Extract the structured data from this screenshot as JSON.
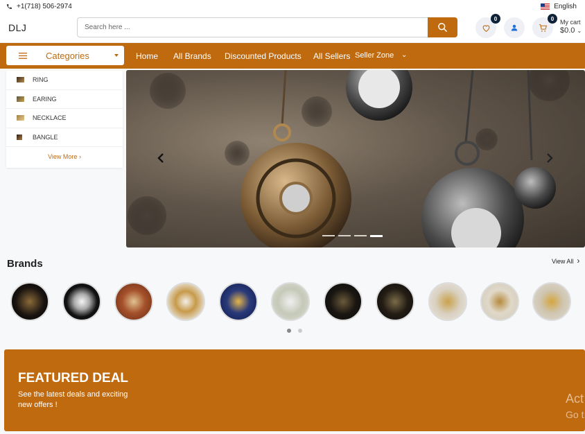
{
  "topbar": {
    "phone": "+1(718) 506-2974",
    "language": "English"
  },
  "header": {
    "logo": "DLJ",
    "search_placeholder": "Search here ...",
    "wishlist_count": "0",
    "cart_count": "0",
    "cart_label": "My cart",
    "cart_amount": "$0.0"
  },
  "nav": {
    "categories_label": "Categories",
    "links": [
      "Home",
      "All Brands",
      "Discounted Products",
      "All Sellers",
      "Seller Zone"
    ]
  },
  "categories": [
    {
      "label": "RING",
      "icon": "ring-thumbnail"
    },
    {
      "label": "EARING",
      "icon": "earing-thumbnail"
    },
    {
      "label": "NECKLACE",
      "icon": "necklace-thumbnail"
    },
    {
      "label": "BANGLE",
      "icon": "bangle-thumbnail"
    }
  ],
  "view_more": "View More",
  "brands": {
    "title": "Brands",
    "view_all": "View All"
  },
  "featured": {
    "title": "FEATURED DEAL",
    "subtitle": "See the latest deals and exciting new offers !"
  },
  "watermark": {
    "line1": "Act",
    "line2": "Go t"
  },
  "colors": {
    "brand": "#c06a10",
    "badge": "#0f2237"
  }
}
